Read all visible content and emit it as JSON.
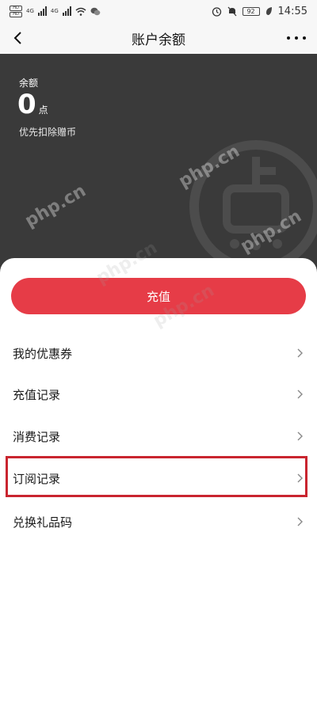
{
  "status_bar": {
    "sim1": "HD",
    "sim2": "HD",
    "network1": "4G",
    "network2": "4G",
    "battery": "92",
    "time": "14:55"
  },
  "nav": {
    "title": "账户余额"
  },
  "balance": {
    "label": "余额",
    "value": "0",
    "unit": "点",
    "note": "优先扣除赠币"
  },
  "watermark": "php.cn",
  "actions": {
    "recharge_label": "充值"
  },
  "menu": {
    "items": [
      {
        "label": "我的优惠券"
      },
      {
        "label": "充值记录"
      },
      {
        "label": "消费记录"
      },
      {
        "label": "订阅记录"
      },
      {
        "label": "兑换礼品码"
      }
    ]
  },
  "colors": {
    "accent": "#e63c47",
    "panel": "#3a3a3a",
    "highlight": "#c9252f"
  }
}
